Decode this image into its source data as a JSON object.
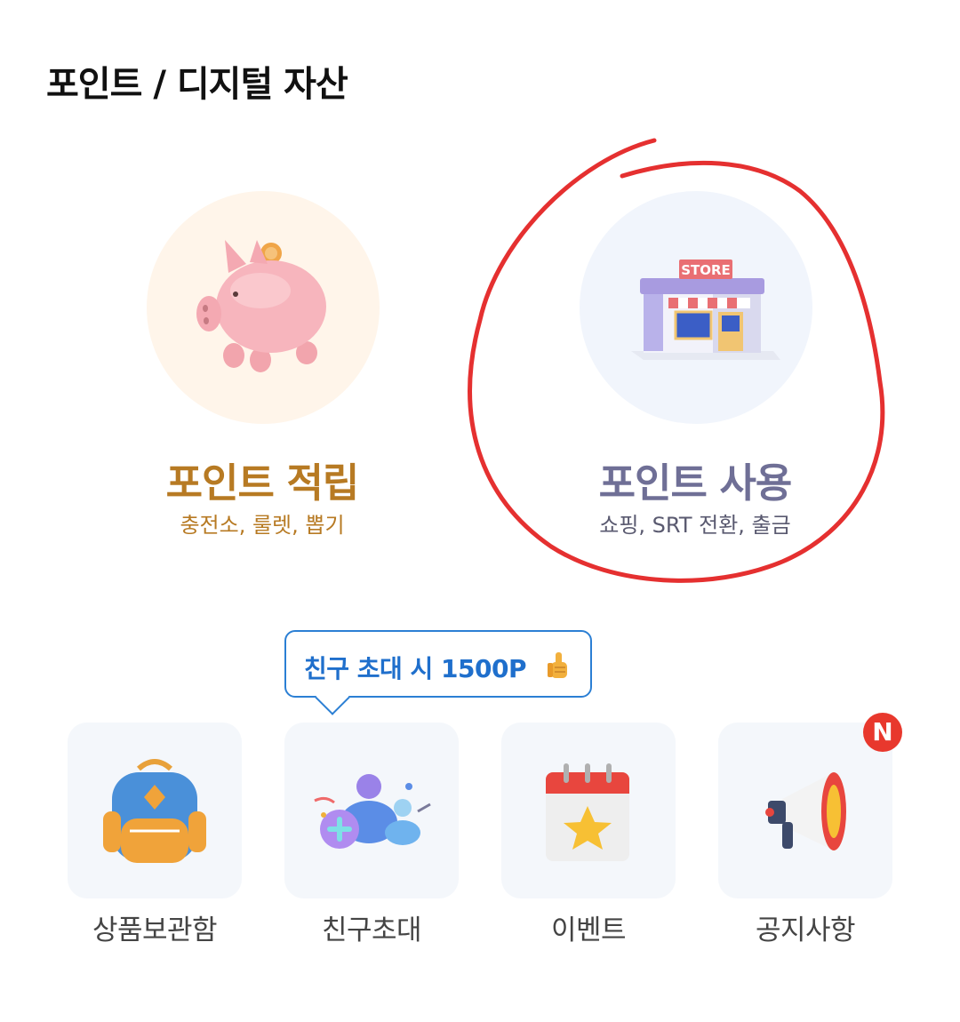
{
  "page": {
    "title": "포인트 / 디지털 자산"
  },
  "cards": {
    "earn": {
      "label": "포인트 적립",
      "sub": "충전소, 룰렛, 뽑기",
      "icon": "piggy-bank-icon"
    },
    "use": {
      "label": "포인트 사용",
      "sub": "쇼핑, SRT 전환, 출금",
      "icon": "store-icon",
      "store_sign": "STORE"
    }
  },
  "tooltip": {
    "text": "친구 초대 시 1500P",
    "icon": "thumbs-up-icon"
  },
  "tiles": [
    {
      "label": "상품보관함",
      "icon": "backpack-icon"
    },
    {
      "label": "친구초대",
      "icon": "invite-friends-icon"
    },
    {
      "label": "이벤트",
      "icon": "calendar-star-icon"
    },
    {
      "label": "공지사항",
      "icon": "megaphone-icon"
    }
  ],
  "badge": {
    "text": "N"
  },
  "colors": {
    "earn_accent": "#b77a23",
    "use_accent": "#6f6f96",
    "tooltip_blue": "#1f6fcc",
    "badge_red": "#e8382d",
    "annotation_red": "#e53030"
  }
}
